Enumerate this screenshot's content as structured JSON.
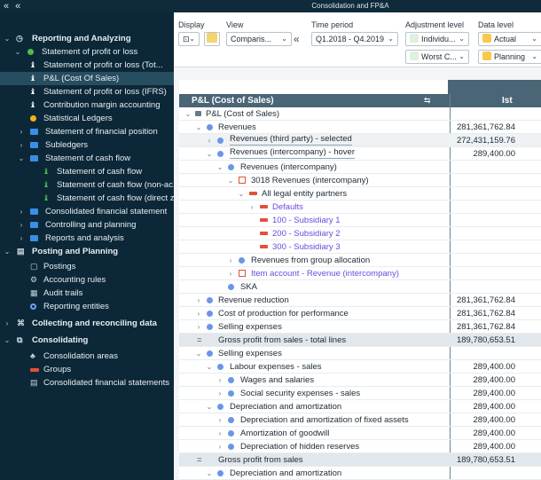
{
  "topbar": {
    "nav": "« «",
    "title": "Consolidation and FP&A"
  },
  "sidebar": {
    "items": [
      {
        "label": "Reporting and Analyzing",
        "chev": "⌄",
        "sym": "◷",
        "bold": true
      },
      {
        "label": "Statement of profit or loss",
        "chev": "⌄",
        "icon": "dot-green"
      },
      {
        "label": "Statement of profit or loss (Tot...",
        "icon": "entity"
      },
      {
        "label": "P&L (Cost Of Sales)",
        "icon": "entity",
        "selected": true
      },
      {
        "label": "Statement of profit or loss (IFRS)",
        "icon": "entity"
      },
      {
        "label": "Contribution margin accounting",
        "icon": "entity"
      },
      {
        "label": "Statistical Ledgers",
        "icon": "dot-orange"
      },
      {
        "label": "Statement of financial position",
        "chev": "›",
        "icon": "folder"
      },
      {
        "label": "Subledgers",
        "chev": "›",
        "icon": "folder"
      },
      {
        "label": "Statement of cash flow",
        "chev": "⌄",
        "icon": "folder"
      },
      {
        "label": "Statement of cash flow",
        "icon": "entity-green"
      },
      {
        "label": "Statement of cash flow (non-ac...",
        "icon": "entity-green"
      },
      {
        "label": "Statement of cash flow (direct z",
        "icon": "entity-green"
      },
      {
        "label": "Consolidated financial statement",
        "chev": "›",
        "icon": "folder"
      },
      {
        "label": "Controlling and planning",
        "chev": "›",
        "icon": "folder"
      },
      {
        "label": "Reports and analysis",
        "chev": "›",
        "icon": "folder"
      },
      {
        "label": "Posting and Planning",
        "chev": "⌄",
        "sym": "▤",
        "bold": true
      },
      {
        "label": "Postings",
        "sym": "▢"
      },
      {
        "label": "Accounting rules",
        "sym": "⚙"
      },
      {
        "label": "Audit trails",
        "sym": "▦"
      },
      {
        "label": "Reporting entities",
        "icon": "dot-blue"
      },
      {
        "label": "Collecting and reconciling data",
        "chev": "›",
        "sym": "⌘",
        "bold": true
      },
      {
        "label": "Consolidating",
        "chev": "⌄",
        "sym": "⧉",
        "bold": true
      },
      {
        "label": "Consolidation areas",
        "sym": "♣"
      },
      {
        "label": "Groups",
        "icon": "bar-red"
      },
      {
        "label": "Consolidated financial statements",
        "sym": "▤"
      }
    ]
  },
  "filters": {
    "display_label": "Display",
    "view_label": "View",
    "view_value": "Comparis...",
    "time_label": "Time period",
    "time_value": "Q1.2018 - Q4.2019",
    "adj_label": "Adjustment level",
    "adj_value1": "Individu...",
    "adj_value2": "Worst C...",
    "data_label": "Data level",
    "data_value1": "Actual",
    "data_value2": "Planning",
    "collapse": "«"
  },
  "grid": {
    "header_account": "P&L (Cost of Sales)",
    "header_ist": "Ist",
    "rows": [
      {
        "label": "P&L (Cost of Sales)",
        "value": ""
      },
      {
        "label": "Revenues",
        "value": "281,361,762.84"
      },
      {
        "label": "Revenues (third party) - selected",
        "value": "272,431,159.76"
      },
      {
        "label": "Revenues (intercompany) - hover",
        "value": "289,400.00"
      },
      {
        "label": "Revenues (intercompany)",
        "value": ""
      },
      {
        "label": "3018 Revenues (intercompany)",
        "value": ""
      },
      {
        "label": "All legal entity partners",
        "value": ""
      },
      {
        "label": "Defaults",
        "value": ""
      },
      {
        "label": "100 - Subsidiary 1",
        "value": ""
      },
      {
        "label": "200 - Subsidiary 2",
        "value": ""
      },
      {
        "label": "300 - Subsidiary 3",
        "value": ""
      },
      {
        "label": "Revenues from group allocation",
        "value": ""
      },
      {
        "label": "Item account - Revenue (intercompany)",
        "value": ""
      },
      {
        "label": "SKA",
        "value": ""
      },
      {
        "label": "Revenue reduction",
        "value": "281,361,762.84"
      },
      {
        "label": "Cost of production for performance",
        "value": "281,361,762.84"
      },
      {
        "label": "Selling expenses",
        "value": "281,361,762.84"
      },
      {
        "label": "Gross profit from sales - total lines",
        "value": "189,780,653.51"
      },
      {
        "label": "Selling expenses",
        "value": ""
      },
      {
        "label": "Labour expenses - sales",
        "value": "289,400.00"
      },
      {
        "label": "Wages and salaries",
        "value": "289,400.00"
      },
      {
        "label": "Social security expenses - sales",
        "value": "289,400.00"
      },
      {
        "label": "Depreciation and amortization",
        "value": "289,400.00"
      },
      {
        "label": "Depreciation and amortization of fixed assets",
        "value": "289,400.00"
      },
      {
        "label": "Amortization of goodwill",
        "value": "289,400.00"
      },
      {
        "label": "Depreciation of hidden reserves",
        "value": "289,400.00"
      },
      {
        "label": "Gross profit from sales",
        "value": "189,780,653.51"
      },
      {
        "label": "Depreciation and amortization",
        "value": ""
      }
    ]
  }
}
